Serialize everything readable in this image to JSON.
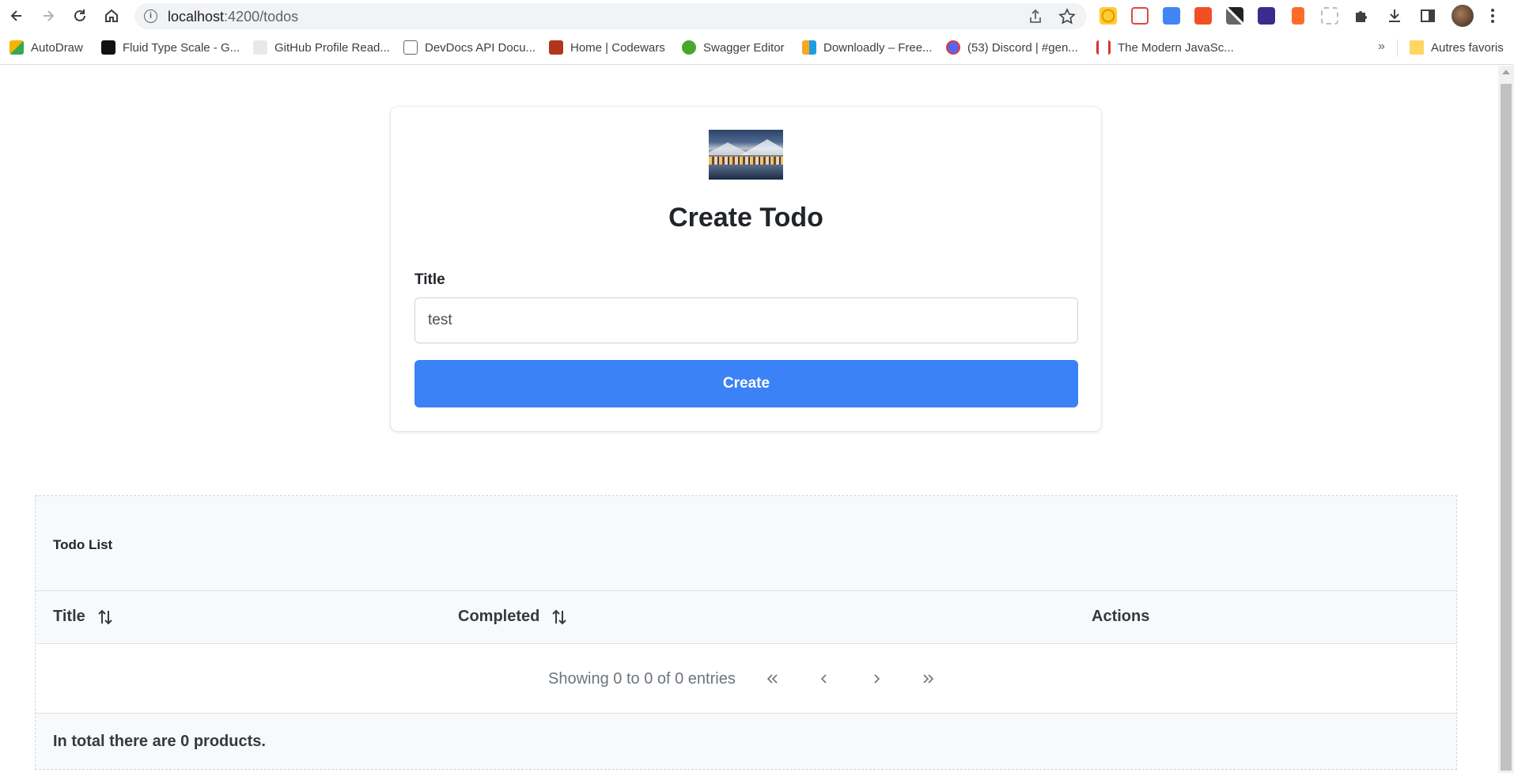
{
  "browser": {
    "url_host": "localhost",
    "url_rest": ":4200/todos",
    "bookmarks": [
      {
        "label": "AutoDraw",
        "color": "#f4b400"
      },
      {
        "label": "Fluid Type Scale - G...",
        "color": "#111111"
      },
      {
        "label": "GitHub Profile Read...",
        "color": "#888888"
      },
      {
        "label": "DevDocs API Docu...",
        "color": "#666666"
      },
      {
        "label": "Home | Codewars",
        "color": "#b1361e"
      },
      {
        "label": "Swagger Editor",
        "color": "#49a82c"
      },
      {
        "label": "Downloadly – Free...",
        "color": "#1a9fe0"
      },
      {
        "label": "(53) Discord | #gen...",
        "color": "#5865f2"
      },
      {
        "label": "The Modern JavaSc...",
        "color": "#d9362b"
      }
    ],
    "more_bookmarks": "»",
    "other_bookmarks": "Autres favoris"
  },
  "form": {
    "heading": "Create Todo",
    "title_label": "Title",
    "title_value": "test",
    "create_label": "Create"
  },
  "table": {
    "caption": "Todo List",
    "columns": {
      "title": "Title",
      "completed": "Completed",
      "actions": "Actions"
    },
    "report": "Showing 0 to 0 of 0 entries",
    "footer": "In total there are 0 products."
  },
  "colors": {
    "primary_button": "#3b82f6",
    "panel_bg": "#f8f9fa"
  }
}
